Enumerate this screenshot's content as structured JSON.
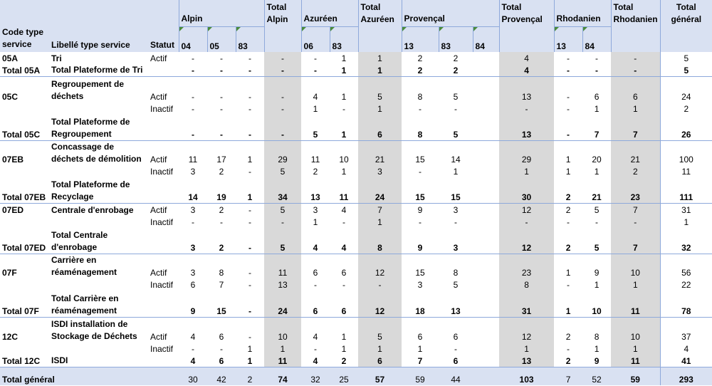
{
  "header": {
    "code": "Code type service",
    "libelle": "Libellé type service",
    "statut": "Statut",
    "groups": {
      "alpin": "Alpin",
      "total_alpin": "Total Alpin",
      "azureen": "Azuréen",
      "total_azureen": "Total Azuréen",
      "provencal": "Provençal",
      "total_provencal": "Total Provençal",
      "rhodanien": "Rhodanien",
      "total_rhodanien": "Total Rhodanien",
      "total_general": "Total général"
    },
    "sub": {
      "a1": "04",
      "a2": "05",
      "a3": "83",
      "z1": "06",
      "z2": "83",
      "p1": "13",
      "p2": "83",
      "p3": "84",
      "r1": "13",
      "r2": "84"
    }
  },
  "rows": [
    {
      "code": "05A",
      "lib": "Tri",
      "statut": "Actif",
      "v": [
        "-",
        "-",
        "-",
        "-",
        "-",
        "1",
        "1",
        "2",
        "2",
        "",
        "4",
        "-",
        "-",
        "-",
        "5"
      ]
    },
    {
      "code": "Total 05A",
      "lib": "Total Plateforme de Tri",
      "statut": "",
      "v": [
        "-",
        "-",
        "-",
        "-",
        "-",
        "1",
        "1",
        "2",
        "2",
        "",
        "4",
        "-",
        "-",
        "-",
        "5"
      ]
    },
    {
      "code": "05C",
      "lib": "Regroupement de déchets",
      "statut": "Actif",
      "v": [
        "-",
        "-",
        "-",
        "-",
        "4",
        "1",
        "5",
        "8",
        "5",
        "",
        "13",
        "-",
        "6",
        "6",
        "24"
      ]
    },
    {
      "code": "",
      "lib": "",
      "statut": "Inactif",
      "v": [
        "-",
        "-",
        "-",
        "-",
        "1",
        "-",
        "1",
        "-",
        "-",
        "",
        "-",
        "-",
        "1",
        "1",
        "2"
      ]
    },
    {
      "code": "Total 05C",
      "lib": "Total Plateforme de Regroupement",
      "statut": "",
      "v": [
        "-",
        "-",
        "-",
        "-",
        "5",
        "1",
        "6",
        "8",
        "5",
        "",
        "13",
        "-",
        "7",
        "7",
        "26"
      ]
    },
    {
      "code": "07EB",
      "lib": "Concassage de déchets de démolition",
      "statut": "Actif",
      "v": [
        "11",
        "17",
        "1",
        "29",
        "11",
        "10",
        "21",
        "15",
        "14",
        "",
        "29",
        "1",
        "20",
        "21",
        "100"
      ]
    },
    {
      "code": "",
      "lib": "",
      "statut": "Inactif",
      "v": [
        "3",
        "2",
        "-",
        "5",
        "2",
        "1",
        "3",
        "-",
        "1",
        "",
        "1",
        "1",
        "1",
        "2",
        "11"
      ]
    },
    {
      "code": "Total 07EB",
      "lib": "Total Plateforme de Recyclage",
      "statut": "",
      "v": [
        "14",
        "19",
        "1",
        "34",
        "13",
        "11",
        "24",
        "15",
        "15",
        "",
        "30",
        "2",
        "21",
        "23",
        "111"
      ]
    },
    {
      "code": "07ED",
      "lib": "Centrale d'enrobage",
      "statut": "Actif",
      "v": [
        "3",
        "2",
        "-",
        "5",
        "3",
        "4",
        "7",
        "9",
        "3",
        "",
        "12",
        "2",
        "5",
        "7",
        "31"
      ]
    },
    {
      "code": "",
      "lib": "",
      "statut": "Inactif",
      "v": [
        "-",
        "-",
        "-",
        "-",
        "1",
        "-",
        "1",
        "-",
        "-",
        "",
        "-",
        "-",
        "-",
        "-",
        "1"
      ]
    },
    {
      "code": "Total 07ED",
      "lib": "Total Centrale d'enrobage",
      "statut": "",
      "v": [
        "3",
        "2",
        "-",
        "5",
        "4",
        "4",
        "8",
        "9",
        "3",
        "",
        "12",
        "2",
        "5",
        "7",
        "32"
      ]
    },
    {
      "code": "07F",
      "lib": "Carrière en réaménagement",
      "statut": "Actif",
      "v": [
        "3",
        "8",
        "-",
        "11",
        "6",
        "6",
        "12",
        "15",
        "8",
        "",
        "23",
        "1",
        "9",
        "10",
        "56"
      ]
    },
    {
      "code": "",
      "lib": "",
      "statut": "Inactif",
      "v": [
        "6",
        "7",
        "-",
        "13",
        "-",
        "-",
        "-",
        "3",
        "5",
        "",
        "8",
        "-",
        "1",
        "1",
        "22"
      ]
    },
    {
      "code": "Total 07F",
      "lib": "Total Carrière en réaménagement",
      "statut": "",
      "v": [
        "9",
        "15",
        "-",
        "24",
        "6",
        "6",
        "12",
        "18",
        "13",
        "",
        "31",
        "1",
        "10",
        "11",
        "78"
      ]
    },
    {
      "code": "12C",
      "lib": "ISDI installation de Stockage de Déchets",
      "statut": "Actif",
      "v": [
        "4",
        "6",
        "-",
        "10",
        "4",
        "1",
        "5",
        "6",
        "6",
        "",
        "12",
        "2",
        "8",
        "10",
        "37"
      ]
    },
    {
      "code": "",
      "lib": "",
      "statut": "Inactif",
      "v": [
        "-",
        "-",
        "1",
        "1",
        "-",
        "1",
        "1",
        "1",
        "-",
        "",
        "1",
        "-",
        "1",
        "1",
        "4"
      ]
    },
    {
      "code": "Total 12C",
      "lib": "ISDI",
      "statut": "",
      "v": [
        "4",
        "6",
        "1",
        "11",
        "4",
        "2",
        "6",
        "7",
        "6",
        "",
        "13",
        "2",
        "9",
        "11",
        "41"
      ]
    }
  ],
  "grand_total": {
    "label": "Total général",
    "v": [
      "30",
      "42",
      "2",
      "74",
      "32",
      "25",
      "57",
      "59",
      "44",
      "",
      "103",
      "7",
      "52",
      "59",
      "293"
    ]
  }
}
